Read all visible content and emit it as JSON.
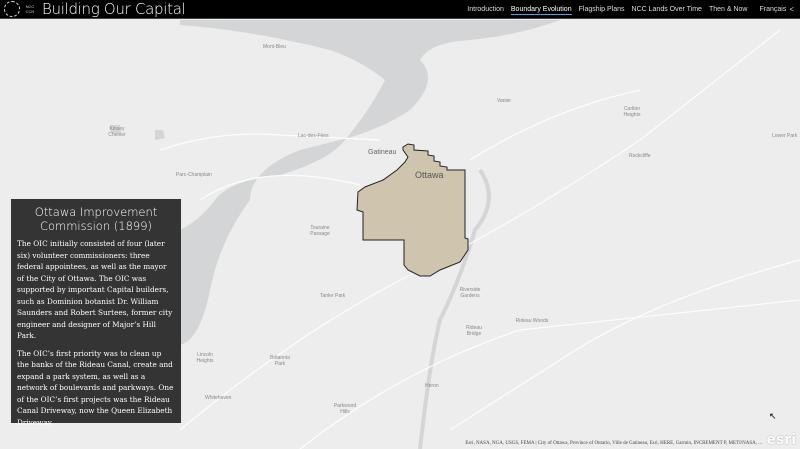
{
  "header": {
    "logo_text": "NCC CCN",
    "title": "Building Our Capital",
    "nav": [
      "Introduction",
      "Boundary Evolution",
      "Flagship Plans",
      "NCC Lands Over Time",
      "Then & Now"
    ],
    "active_nav": "Boundary Evolution",
    "language": "Français",
    "share_icon": "share-icon"
  },
  "map": {
    "labels": {
      "gatineau": "Gatineau",
      "ottawa": "Ottawa",
      "mont_bleu": "Mont-Bleu",
      "kinsey": "Kinsey Chenier",
      "parc_champlain": "Parc-Champlain",
      "lac_des_fees": "Lac-des-Fées",
      "vanier": "Vanier",
      "carlton": "Carlton Heights",
      "lower_park": "Lower Park",
      "rockcliffe": "Rockcliffe",
      "touraine": "Touraine Passage",
      "tanler_park": "Tanler Park",
      "lincoln_heights": "Lincoln Heights",
      "britannia": "Britannia Park",
      "whitehaven": "Whitehaven",
      "parkwood_hills": "Parkwood Hills",
      "riverside": "Riverside Gardens",
      "rideau_bridge": "Rideau Bridge",
      "rideau_woods": "Rideau Woods",
      "heron": "Heron"
    },
    "boundary_fill": "#cfc5ae"
  },
  "panel": {
    "title": "Ottawa Improvement Commission (1899)",
    "paragraphs": [
      "The OIC initially consisted of four (later six) volunteer commissioners: three federal appointees, as well as the mayor of the City of Ottawa. The OIC was supported by important Capital builders, such as Dominion botanist Dr. William Saunders and Robert Surtees, former city engineer and designer of Major’s Hill Park.",
      "The OIC’s first priority was to clean up the banks of the Rideau Canal, create and expand a park system, as well as a network of boulevards and parkways. One of the OIC’s first projects was the Rideau Canal Driveway, now the Queen Elizabeth Driveway."
    ]
  },
  "attribution": "Esri, NASA, NGA, USGS, FEMA | City of Ottawa, Province of Ontario, Ville de Gatineau, Esri, HERE, Garmin, INCREMENT P, METI/NASA, ...",
  "esri_logo": "esri"
}
